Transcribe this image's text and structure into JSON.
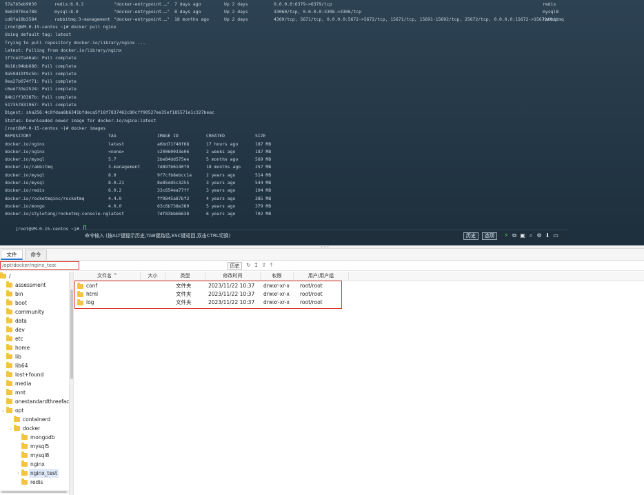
{
  "terminal": {
    "top_rows": [
      {
        "id": "57a7b5eb9030",
        "image": "redis:6.0.2",
        "command": "\"docker-entrypoint.…\"",
        "created": "7 days ago",
        "status": "Up 2 days",
        "ports": "0.0.0.0:6379->6379/tcp",
        "name": "redis"
      },
      {
        "id": "9e63970ce788",
        "image": "mysql:8.0",
        "command": "\"docker-entrypoint.…\"",
        "created": "8 days ago",
        "status": "Up 2 days",
        "ports": "33060/tcp, 0.0.0.0:3308->3306/tcp",
        "name": "mysql8"
      },
      {
        "id": "cd8fa18b3584",
        "image": "rabbitmq:3-management",
        "command": "\"docker-entrypoint.…\"",
        "created": "18 months ago",
        "status": "Up 2 days",
        "ports": "4369/tcp, 5671/tcp, 0.0.0.0:5672->5672/tcp, 15671/tcp, 15691-15692/tcp, 25672/tcp, 0.0.0.0:15672->15672/tcp",
        "name": "rabbitmq"
      }
    ],
    "log_lines": [
      "[root@VM-0-15-centos ~]# docker pull nginx",
      "Using default tag: latest",
      "Trying to pull repository docker.io/library/nginx ...",
      "latest: Pulling from docker.io/library/nginx",
      "1f7ce2fa46ab: Pull complete",
      "9b16c94bb686: Pull complete",
      "9a59d19f9c5b: Pull complete",
      "9ea27b074f71: Pull complete",
      "c6edf33e2524: Pull complete",
      "84b1ff10387b: Pull complete",
      "517357831967: Pull complete",
      "Digest: sha256:4c0fdaa8b6341bfdeca5f18f7837462c80cff90527ee35ef185571e1c327beac",
      "Status: Downloaded newer image for docker.io/nginx:latest",
      "[root@VM-0-15-centos ~]# docker images"
    ],
    "images_header": {
      "repository": "REPOSITORY",
      "tag": "TAG",
      "image_id": "IMAGE ID",
      "created": "CREATED",
      "size": "SIZE"
    },
    "images": [
      {
        "repository": "docker.io/nginx",
        "tag": "latest",
        "image_id": "a6bd71f48f68",
        "created": "17 hours ago",
        "size": "187 MB"
      },
      {
        "repository": "docker.io/nginx",
        "tag": "<none>",
        "image_id": "c20060033e06",
        "created": "2 weeks ago",
        "size": "187 MB"
      },
      {
        "repository": "docker.io/mysql",
        "tag": "5.7",
        "image_id": "2be84dd575ee",
        "created": "5 months ago",
        "size": "569 MB"
      },
      {
        "repository": "docker.io/rabbitmq",
        "tag": "3-management",
        "image_id": "7d89fb6140f9",
        "created": "18 months ago",
        "size": "257 MB"
      },
      {
        "repository": "docker.io/mysql",
        "tag": "8.0",
        "image_id": "9f7cfb8ebcc1a",
        "created": "2 years ago",
        "size": "514 MB"
      },
      {
        "repository": "docker.io/mysql",
        "tag": "8.0.21",
        "image_id": "8e85dd5c3255",
        "created": "3 years ago",
        "size": "544 MB"
      },
      {
        "repository": "docker.io/redis",
        "tag": "6.0.2",
        "image_id": "33c654ea77ff",
        "created": "3 years ago",
        "size": "104 MB"
      },
      {
        "repository": "docker.io/rocketmqinc/rocketmq",
        "tag": "4.4.0",
        "image_id": "ff0845a87bf3",
        "created": "4 years ago",
        "size": "385 MB"
      },
      {
        "repository": "docker.io/mongo",
        "tag": "4.0.0",
        "image_id": "63c6b738e389",
        "created": "5 years ago",
        "size": "379 MB"
      },
      {
        "repository": "docker.io/styletang/rocketmq-console-ng",
        "tag": "latest",
        "image_id": "7df83bbb6638",
        "created": "6 years ago",
        "size": "702 MB"
      }
    ],
    "prompt": "[root@VM-0-15-centos ~]# "
  },
  "command_bar": {
    "hint": "命令输入 (按ALT键提示历史,TAB键路径,ESC键返回,双击CTRL切换)",
    "history_label": "历史",
    "options_label": "选项",
    "icons": [
      "lightning-icon",
      "copy-icon",
      "paste-icon",
      "search-icon",
      "gear-icon",
      "download-icon",
      "window-icon"
    ]
  },
  "tabs": [
    {
      "label": "文件",
      "active": true
    },
    {
      "label": "命令",
      "active": false
    }
  ],
  "path_bar": {
    "path": "/opt/docker/nginx_test",
    "history_label": "历史"
  },
  "tree": [
    {
      "label": "/",
      "depth": 0,
      "expanded": true
    },
    {
      "label": "assessment",
      "depth": 1
    },
    {
      "label": "bin",
      "depth": 1
    },
    {
      "label": "boot",
      "depth": 1
    },
    {
      "label": "community",
      "depth": 1
    },
    {
      "label": "data",
      "depth": 1
    },
    {
      "label": "dev",
      "depth": 1
    },
    {
      "label": "etc",
      "depth": 1
    },
    {
      "label": "home",
      "depth": 1
    },
    {
      "label": "lib",
      "depth": 1
    },
    {
      "label": "lib64",
      "depth": 1
    },
    {
      "label": "lost+found",
      "depth": 1
    },
    {
      "label": "media",
      "depth": 1
    },
    {
      "label": "mnt",
      "depth": 1
    },
    {
      "label": "onestandardthreefact",
      "depth": 1
    },
    {
      "label": "opt",
      "depth": 1,
      "expanded": true
    },
    {
      "label": "containerd",
      "depth": 2
    },
    {
      "label": "docker",
      "depth": 2,
      "expanded": true
    },
    {
      "label": "mongodb",
      "depth": 3
    },
    {
      "label": "mysql5",
      "depth": 3
    },
    {
      "label": "mysql8",
      "depth": 3
    },
    {
      "label": "nginx",
      "depth": 3
    },
    {
      "label": "nginx_test",
      "depth": 3,
      "selected": true,
      "collapsed_arrow": true
    },
    {
      "label": "redis",
      "depth": 3
    }
  ],
  "file_table": {
    "headers": {
      "name": "文件名 ^",
      "size": "大小",
      "type": "类型",
      "modified": "修改时间",
      "perm": "权限",
      "owner": "用户/用户组"
    },
    "rows": [
      {
        "name": "conf",
        "size": "",
        "type": "文件夹",
        "modified": "2023/11/22 10:37",
        "perm": "drwxr-xr-x",
        "owner": "root/root"
      },
      {
        "name": "html",
        "size": "",
        "type": "文件夹",
        "modified": "2023/11/22 10:37",
        "perm": "drwxr-xr-x",
        "owner": "root/root"
      },
      {
        "name": "log",
        "size": "",
        "type": "文件夹",
        "modified": "2023/11/22 10:37",
        "perm": "drwxr-xr-x",
        "owner": "root/root"
      }
    ]
  },
  "colors": {
    "highlight_border": "#d9362b",
    "folder": "#f3c341",
    "cursor": "#3be24a"
  }
}
